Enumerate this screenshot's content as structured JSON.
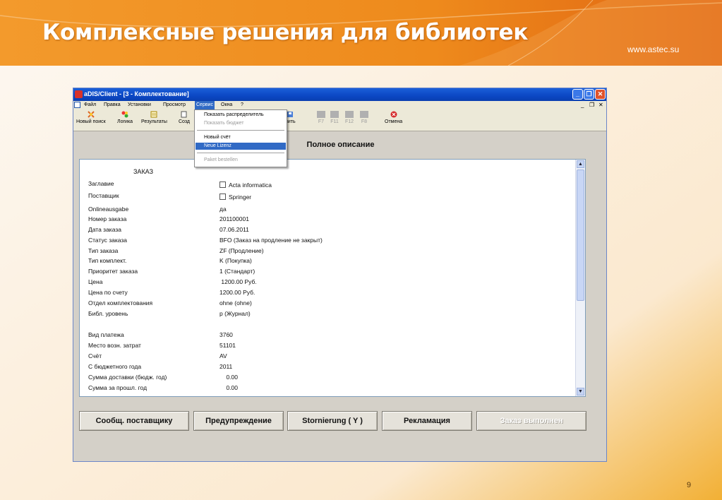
{
  "slide": {
    "title": "Комплексные решения для библиотек",
    "url": "www.astec.su",
    "page_number": "9",
    "colors": {
      "banner_orange": "#f0901e",
      "banner_dark": "#e06a10",
      "titlebar_blue": "#0b47c4",
      "selection_blue": "#316ac5"
    }
  },
  "window": {
    "title": "aDIS/Client - [3 - Комплектование]",
    "caption_buttons": {
      "minimize": "_",
      "restore": "❐",
      "close": "✕"
    },
    "menu": [
      "Файл",
      "Правка",
      "Установки",
      "Просмотр",
      "Сервис",
      "Окна",
      "?"
    ],
    "menu_active": "Сервис",
    "mdi_controls": {
      "minimize": "_",
      "restore": "❐",
      "close": "✕"
    },
    "toolbar": {
      "new_search": "Новый поиск",
      "logic": "Логика",
      "results": "Результаты",
      "create": "Созд",
      "save_partial": "нить",
      "f7": "F7",
      "f11": "F11",
      "f12": "F12",
      "f8": "F8",
      "cancel": "Отмена"
    },
    "dropdown": {
      "items": [
        {
          "label": "Показать распределитель",
          "enabled": true
        },
        {
          "label": "Показать бюджет",
          "enabled": false
        },
        {
          "label": "Новый счёт",
          "enabled": true
        },
        {
          "label": "Neue Lizenz",
          "enabled": true,
          "selected": true
        },
        {
          "label": "Paket bestellen",
          "enabled": false
        }
      ]
    },
    "section_title": "Полное описание",
    "record": {
      "header": "ЗАКАЗ",
      "title_label": "Заглавие",
      "title_value": "Acta informatica",
      "supplier_label": "Поставщик",
      "supplier_value": "Springer",
      "fields_a": [
        {
          "label": "Onlineausgabe",
          "value": "да"
        },
        {
          "label": "Номер заказа",
          "value": "201100001"
        },
        {
          "label": "Дата заказа",
          "value": "07.06.2011"
        },
        {
          "label": "Статус заказа",
          "value": "BFO (Заказ на продление не закрыт)"
        },
        {
          "label": "Тип заказа",
          "value": "ZF (Продление)"
        },
        {
          "label": "Тип комплект.",
          "value": "K (Покупка)"
        },
        {
          "label": "Приоритет заказа",
          "value": "1 (Стандарт)"
        },
        {
          "label": "Цена",
          "value": " 1200.00 Руб."
        },
        {
          "label": "Цена по счету",
          "value": "1200.00 Руб."
        },
        {
          "label": "Отдел комплектования",
          "value": "ohne (ohne)"
        },
        {
          "label": "Библ. уровень",
          "value": "p (Журнал)"
        }
      ],
      "fields_b": [
        {
          "label": "Вид платежа",
          "value": "3760"
        },
        {
          "label": "Место возн. затрат",
          "value": "51101"
        },
        {
          "label": "Счёт",
          "value": "AV"
        },
        {
          "label": "С бюджетного года",
          "value": "2011"
        },
        {
          "label": "Сумма доставки (бюдж. год)",
          "value": "    0.00"
        },
        {
          "label": "Сумма за прошл. год",
          "value": "    0.00"
        }
      ]
    },
    "buttons": {
      "notify_supplier": "Сообщ. поставщику",
      "warning": "Предупреждение",
      "stornierung": "Stornierung ( Y )",
      "claim": "Рекламация",
      "order_done": "Заказ выполнен"
    }
  }
}
